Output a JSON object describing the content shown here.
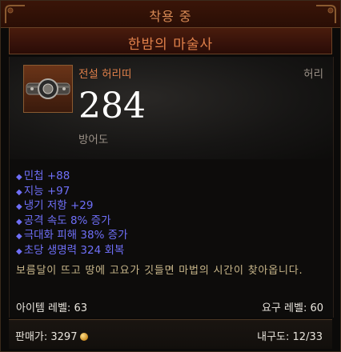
{
  "header": {
    "title": "착용 중"
  },
  "item": {
    "name": "한밤의 마술사",
    "type": "전설 허리띠",
    "slot": "허리",
    "armor_value": "284",
    "armor_label": "방어도",
    "icon": "belt-icon",
    "stats": [
      "민첩 +88",
      "지능 +97",
      "냉기 저항 +29",
      "공격 속도 8% 증가",
      "극대화 피해 38% 증가",
      "초당 생명력 324 회복"
    ],
    "flavor_text": "보름달이 뜨고 땅에 고요가 깃들면 마법의 시간이 찾아옵니다.",
    "item_level": "아이템 레벨: 63",
    "required_level": "요구 레벨: 60",
    "sell_value": "판매가: 3297",
    "durability": "내구도: 12/33"
  },
  "colors": {
    "legendary": "#e0804a",
    "magic_stat": "#6f6ff8",
    "flavor": "#c8b68a"
  }
}
